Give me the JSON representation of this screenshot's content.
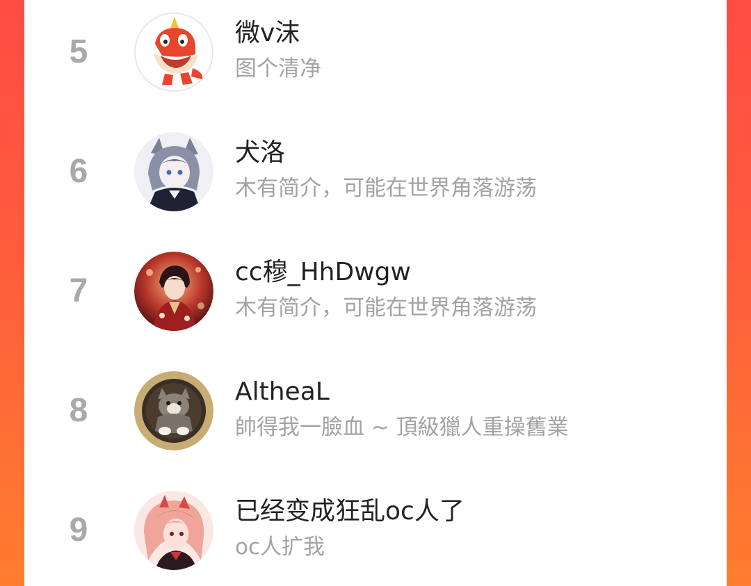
{
  "ranking": {
    "rows": [
      {
        "rank": "5",
        "name": "微v沫",
        "bio": "图个清净",
        "avatar_icon": "fuecoco-dino-avatar"
      },
      {
        "rank": "6",
        "name": "犬洛",
        "bio": "木有简介，可能在世界角落游荡",
        "avatar_icon": "wolf-boy-avatar"
      },
      {
        "rank": "7",
        "name": "cc穆_HhDwgw",
        "bio": "木有简介，可能在世界角落游荡",
        "avatar_icon": "red-robe-avatar"
      },
      {
        "rank": "8",
        "name": "AltheaL",
        "bio": "帥得我一臉血 ~ 頂級獵人重操舊業",
        "avatar_icon": "cat-avatar"
      },
      {
        "rank": "9",
        "name": "已经变成狂乱oc人了",
        "bio": "oc人扩我",
        "avatar_icon": "pink-hair-avatar"
      }
    ]
  },
  "colors": {
    "frame_gradient_top": "#ff4c45",
    "frame_gradient_bottom": "#ff7d2f",
    "rank_text": "#a9a9a9",
    "name_text": "#222222",
    "bio_text": "#a3a3a3"
  }
}
